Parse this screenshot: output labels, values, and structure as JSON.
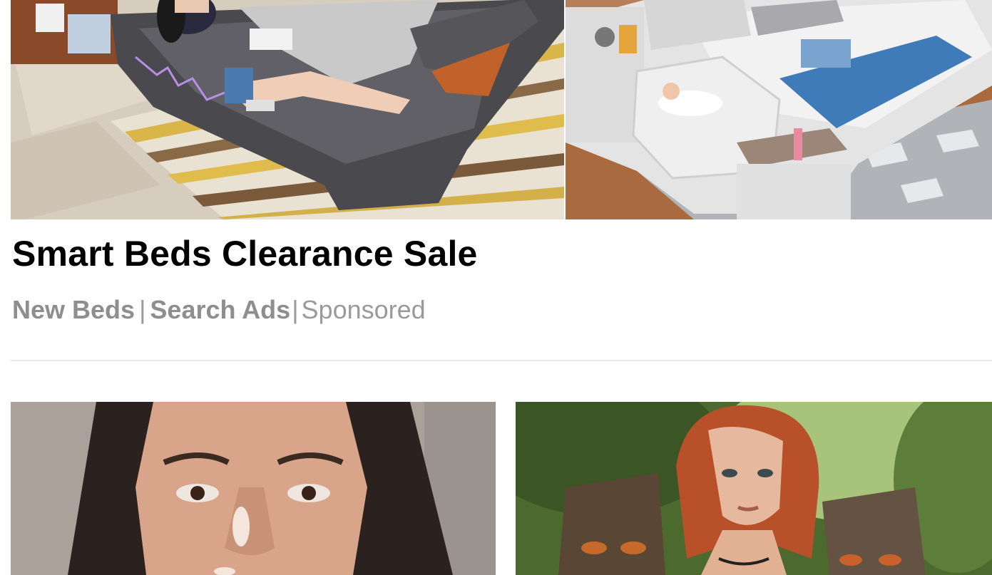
{
  "ad": {
    "headline": "Smart Beds Clearance Sale",
    "source_primary": "New Beds",
    "separator": "|",
    "source_secondary": "Search Ads",
    "sponsored_label": "Sponsored"
  },
  "images": {
    "top_left": "smart-bed-sofa-photo",
    "top_right": "smart-bed-with-crib-photo",
    "bottom_left": "woman-portrait-photo",
    "bottom_right": "fantasy-forest-woman-photo"
  },
  "colors": {
    "headline": "#000000",
    "meta_text": "#8c8c8c",
    "divider": "#e9e9e9",
    "background": "#ffffff"
  }
}
